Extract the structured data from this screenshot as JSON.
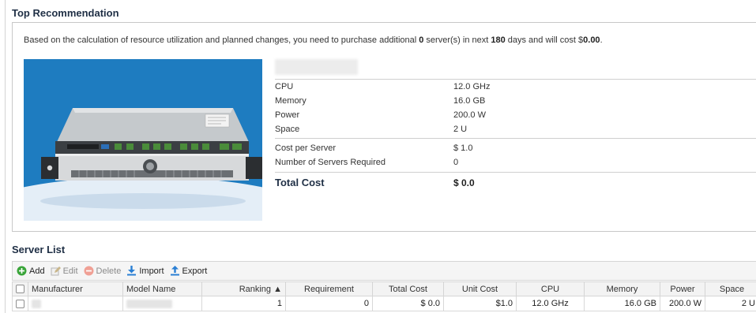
{
  "recommendation": {
    "title": "Top Recommendation",
    "summary_prefix": "Based on the calculation of resource utilization and planned changes, you need to purchase additional ",
    "servers_needed": "0",
    "summary_mid": " server(s) in next ",
    "days": "180",
    "summary_mid2": " days and will cost $",
    "cost": "0.00",
    "summary_suffix": "."
  },
  "specs": {
    "cpu_label": "CPU",
    "cpu_value": "12.0 GHz",
    "memory_label": "Memory",
    "memory_value": "16.0 GB",
    "power_label": "Power",
    "power_value": "200.0 W",
    "space_label": "Space",
    "space_value": "2 U",
    "cost_per_server_label": "Cost per Server",
    "cost_per_server_value": "$ 1.0",
    "num_servers_label": "Number of Servers Required",
    "num_servers_value": "0",
    "total_cost_label": "Total Cost",
    "total_cost_value": "$ 0.0"
  },
  "server_list": {
    "title": "Server List",
    "toolbar": {
      "add": "Add",
      "edit": "Edit",
      "delete": "Delete",
      "import": "Import",
      "export": "Export"
    },
    "columns": [
      "Manufacturer",
      "Model Name",
      "Ranking ▲",
      "Requirement",
      "Total Cost",
      "Unit Cost",
      "CPU",
      "Memory",
      "Power",
      "Space"
    ],
    "rows": [
      {
        "ranking": "1",
        "requirement": "0",
        "total_cost": "$ 0.0",
        "unit_cost": "$1.0",
        "cpu": "12.0 GHz",
        "memory": "16.0 GB",
        "power": "200.0 W",
        "space": "2 U"
      }
    ]
  },
  "colors": {
    "title": "#1f2f45",
    "image_bg": "#1e7cc0",
    "add_icon": "#3aa53a",
    "delete_icon": "#e06050",
    "import_export_icon": "#2a7fd4"
  },
  "icons": [
    "plus-circle-icon",
    "edit-pencil-icon",
    "delete-circle-icon",
    "import-arrow-icon",
    "export-arrow-icon"
  ]
}
